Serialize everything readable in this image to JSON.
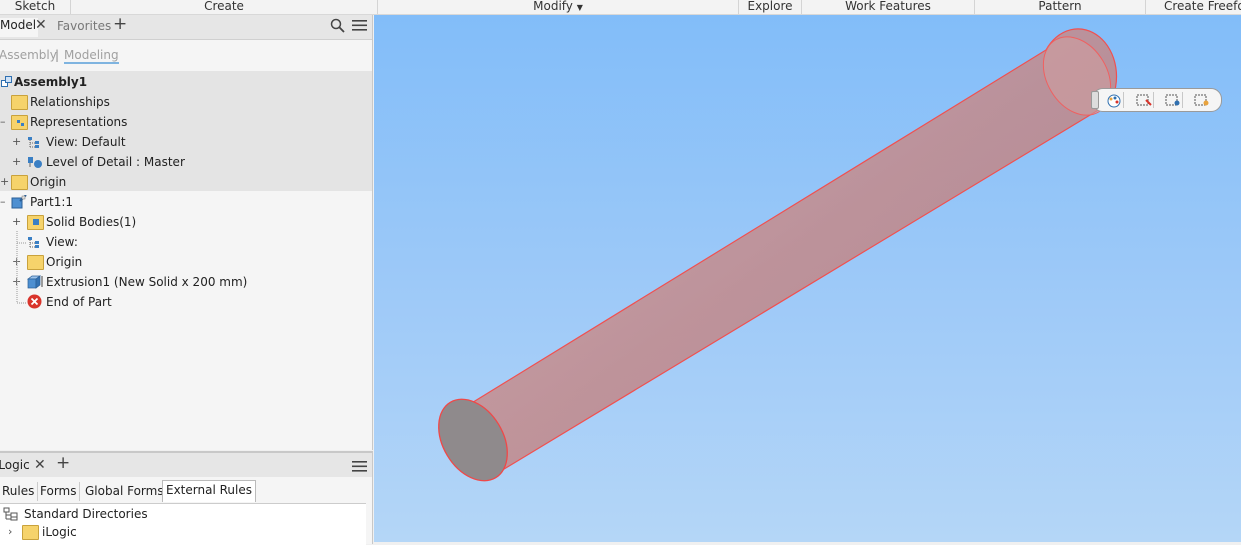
{
  "ribbon": {
    "groups": [
      "Sketch",
      "Create",
      "Modify",
      "Explore",
      "Work Features",
      "Pattern",
      "Create Freeform"
    ]
  },
  "browser": {
    "tab_model": "Model",
    "tab_favorites": "Favorites",
    "mode_assembly": "Assembly",
    "mode_modeling": "Modeling",
    "tree": [
      {
        "label": "Assembly1",
        "icon": "assembly-icon"
      },
      {
        "label": "Relationships",
        "icon": "folder-icon"
      },
      {
        "label": "Representations",
        "icon": "representations-icon"
      },
      {
        "label": "View: Default",
        "icon": "view-rep-icon"
      },
      {
        "label": "Level of Detail : Master",
        "icon": "lod-icon"
      },
      {
        "label": "Origin",
        "icon": "folder-icon"
      },
      {
        "label": "Part1:1",
        "icon": "part-icon"
      },
      {
        "label": "Solid Bodies(1)",
        "icon": "solid-bodies-folder-icon"
      },
      {
        "label": "View:",
        "icon": "view-rep-icon"
      },
      {
        "label": "Origin",
        "icon": "folder-icon"
      },
      {
        "label": "Extrusion1 (New Solid x 200 mm)",
        "icon": "extrusion-icon"
      },
      {
        "label": "End of Part",
        "icon": "end-of-part-icon"
      }
    ]
  },
  "logic": {
    "tab_logic": "iLogic",
    "tabs": [
      "Rules",
      "Forms",
      "Global Forms",
      "External Rules"
    ],
    "active_tab": "External Rules",
    "items": [
      {
        "label": "Standard Directories",
        "icon": "directories-icon"
      },
      {
        "label": "iLogic",
        "icon": "folder-icon"
      }
    ]
  },
  "colors": {
    "viewport_top": "#82bdf9",
    "viewport_bottom": "#b4d6f7",
    "cylinder_fill": "#c98e8e",
    "cylinder_edge": "#ff4444",
    "folder": "#f6d36b"
  }
}
